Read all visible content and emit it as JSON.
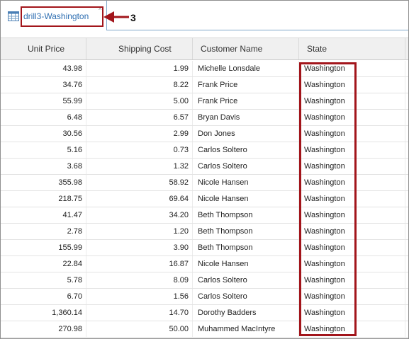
{
  "tab": {
    "label": "drill3-Washington",
    "icon": "table-icon",
    "close_glyph": "x"
  },
  "callout": {
    "number": "3",
    "color": "#a2151b"
  },
  "columns": {
    "unit_price": "Unit Price",
    "shipping_cost": "Shipping Cost",
    "customer_name": "Customer Name",
    "state": "State"
  },
  "rows": [
    {
      "unit_price": "43.98",
      "shipping_cost": "1.99",
      "customer_name": "Michelle Lonsdale",
      "state": "Washington"
    },
    {
      "unit_price": "34.76",
      "shipping_cost": "8.22",
      "customer_name": "Frank Price",
      "state": "Washington"
    },
    {
      "unit_price": "55.99",
      "shipping_cost": "5.00",
      "customer_name": "Frank Price",
      "state": "Washington"
    },
    {
      "unit_price": "6.48",
      "shipping_cost": "6.57",
      "customer_name": "Bryan Davis",
      "state": "Washington"
    },
    {
      "unit_price": "30.56",
      "shipping_cost": "2.99",
      "customer_name": "Don Jones",
      "state": "Washington"
    },
    {
      "unit_price": "5.16",
      "shipping_cost": "0.73",
      "customer_name": "Carlos Soltero",
      "state": "Washington"
    },
    {
      "unit_price": "3.68",
      "shipping_cost": "1.32",
      "customer_name": "Carlos Soltero",
      "state": "Washington"
    },
    {
      "unit_price": "355.98",
      "shipping_cost": "58.92",
      "customer_name": "Nicole Hansen",
      "state": "Washington"
    },
    {
      "unit_price": "218.75",
      "shipping_cost": "69.64",
      "customer_name": "Nicole Hansen",
      "state": "Washington"
    },
    {
      "unit_price": "41.47",
      "shipping_cost": "34.20",
      "customer_name": "Beth Thompson",
      "state": "Washington"
    },
    {
      "unit_price": "2.78",
      "shipping_cost": "1.20",
      "customer_name": "Beth Thompson",
      "state": "Washington"
    },
    {
      "unit_price": "155.99",
      "shipping_cost": "3.90",
      "customer_name": "Beth Thompson",
      "state": "Washington"
    },
    {
      "unit_price": "22.84",
      "shipping_cost": "16.87",
      "customer_name": "Nicole Hansen",
      "state": "Washington"
    },
    {
      "unit_price": "5.78",
      "shipping_cost": "8.09",
      "customer_name": "Carlos Soltero",
      "state": "Washington"
    },
    {
      "unit_price": "6.70",
      "shipping_cost": "1.56",
      "customer_name": "Carlos Soltero",
      "state": "Washington"
    },
    {
      "unit_price": "1,360.14",
      "shipping_cost": "14.70",
      "customer_name": "Dorothy Badders",
      "state": "Washington"
    },
    {
      "unit_price": "270.98",
      "shipping_cost": "50.00",
      "customer_name": "Muhammed MacIntyre",
      "state": "Washington"
    }
  ]
}
